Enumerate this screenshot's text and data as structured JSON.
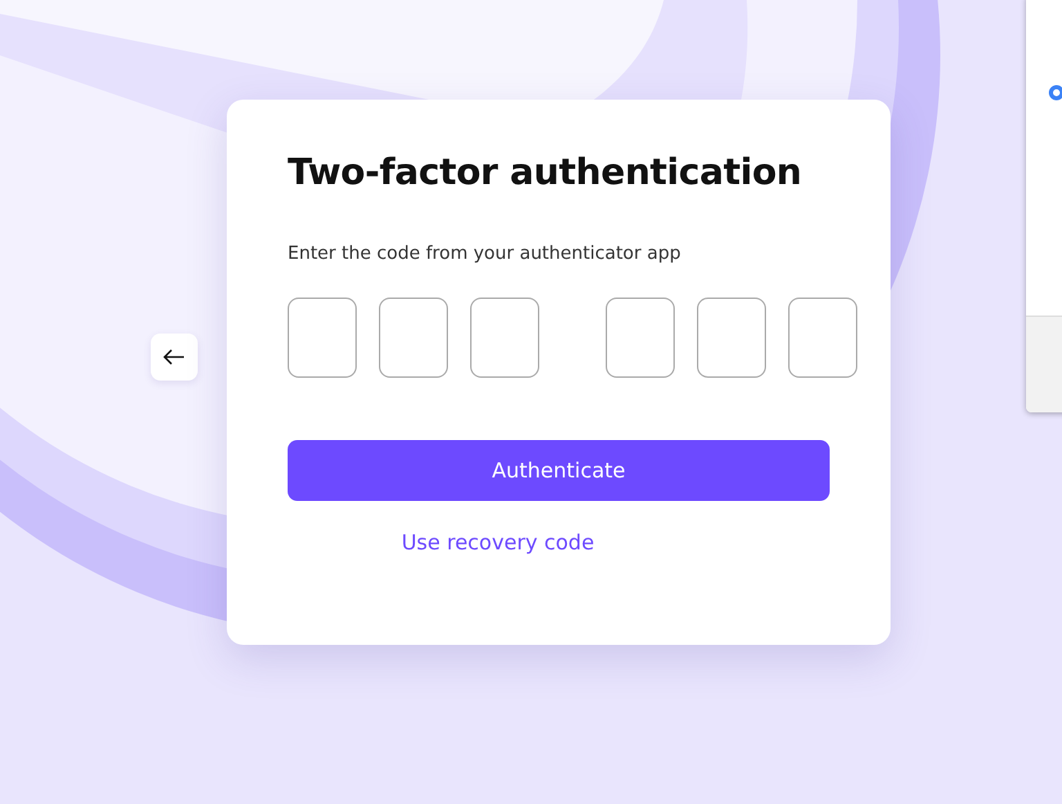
{
  "dialog": {
    "title": "Two-factor authentication",
    "instruction": "Enter the code from your authenticator app",
    "code_fields": [
      {
        "kind": "digit"
      },
      {
        "kind": "digit"
      },
      {
        "kind": "digit"
      },
      {
        "kind": "spacer"
      },
      {
        "kind": "digit"
      },
      {
        "kind": "digit"
      },
      {
        "kind": "digit"
      }
    ],
    "submit_button": "Authenticate",
    "recovery_link": "Use recovery code"
  }
}
